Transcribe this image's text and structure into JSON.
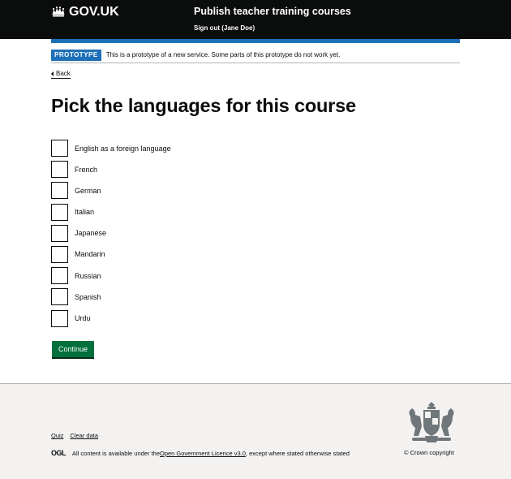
{
  "header": {
    "logo_text": "GOV.UK",
    "service_name": "Publish teacher training courses",
    "sign_out": "Sign out (Jane Doe)"
  },
  "phase_banner": {
    "tag": "PROTOTYPE",
    "text": "This is a prototype of a new service. Some parts of this prototype do not work yet."
  },
  "back_link": "Back",
  "page_title": "Pick the languages for this course",
  "languages": [
    {
      "label": "English as a foreign language",
      "checked": false
    },
    {
      "label": "French",
      "checked": false
    },
    {
      "label": "German",
      "checked": false
    },
    {
      "label": "Italian",
      "checked": false
    },
    {
      "label": "Japanese",
      "checked": false
    },
    {
      "label": "Mandarin",
      "checked": false
    },
    {
      "label": "Russian",
      "checked": false
    },
    {
      "label": "Spanish",
      "checked": false
    },
    {
      "label": "Urdu",
      "checked": false
    }
  ],
  "continue_button": "Continue",
  "footer": {
    "links": [
      "Quiz",
      "Clear data"
    ],
    "ogl": "OGL",
    "licence_prefix": "All content is available under the ",
    "licence_link": "Open Government Licence v3.0",
    "licence_suffix": ", except where stated otherwise stated",
    "copyright": "© Crown copyright"
  },
  "colors": {
    "header_bg": "#0b0c0c",
    "brand_blue": "#1d70b8",
    "button_green": "#00703c",
    "footer_bg": "#f3f2f1"
  }
}
